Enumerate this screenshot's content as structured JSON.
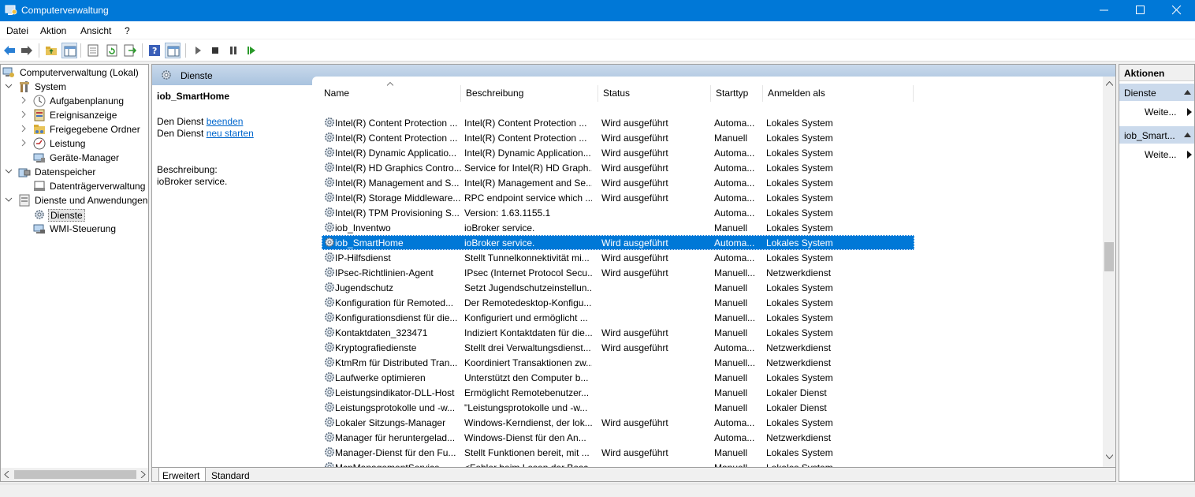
{
  "window": {
    "title": "Computerverwaltung"
  },
  "menu": [
    "Datei",
    "Aktion",
    "Ansicht",
    "?"
  ],
  "tree": {
    "root": "Computerverwaltung (Lokal)",
    "system": "System",
    "aufgaben": "Aufgabenplanung",
    "ereignis": "Ereignisanzeige",
    "freigaben": "Freigegebene Ordner",
    "leistung": "Leistung",
    "geraete": "Geräte-Manager",
    "datenspeicher": "Datenspeicher",
    "datentraeger": "Datenträgerverwaltung",
    "dienste_apps": "Dienste und Anwendungen",
    "dienste": "Dienste",
    "wmi": "WMI-Steuerung"
  },
  "center": {
    "header": "Dienste",
    "selected_service": "iob_SmartHome",
    "stop_prefix": "Den Dienst ",
    "stop_link": "beenden",
    "restart_prefix": "Den Dienst ",
    "restart_link": "neu starten",
    "desc_label": "Beschreibung:",
    "desc_value": "ioBroker service."
  },
  "columns": [
    "Name",
    "Beschreibung",
    "Status",
    "Starttyp",
    "Anmelden als"
  ],
  "rows": [
    [
      "Intel(R) Content Protection ...",
      "Intel(R) Content Protection ...",
      "Wird ausgeführt",
      "Automa...",
      "Lokales System"
    ],
    [
      "Intel(R) Content Protection ...",
      "Intel(R) Content Protection ...",
      "Wird ausgeführt",
      "Manuell",
      "Lokales System"
    ],
    [
      "Intel(R) Dynamic Applicatio...",
      "Intel(R) Dynamic Application...",
      "Wird ausgeführt",
      "Automa...",
      "Lokales System"
    ],
    [
      "Intel(R) HD Graphics Contro...",
      "Service for Intel(R) HD Graph...",
      "Wird ausgeführt",
      "Automa...",
      "Lokales System"
    ],
    [
      "Intel(R) Management and S...",
      "Intel(R) Management and Se...",
      "Wird ausgeführt",
      "Automa...",
      "Lokales System"
    ],
    [
      "Intel(R) Storage Middleware...",
      "RPC endpoint service which ...",
      "Wird ausgeführt",
      "Automa...",
      "Lokales System"
    ],
    [
      "Intel(R) TPM Provisioning S...",
      "Version: 1.63.1155.1",
      "",
      "Automa...",
      "Lokales System"
    ],
    [
      "iob_Inventwo",
      "ioBroker service.",
      "",
      "Manuell",
      "Lokales System"
    ],
    [
      "iob_SmartHome",
      "ioBroker service.",
      "Wird ausgeführt",
      "Automa...",
      "Lokales System"
    ],
    [
      "IP-Hilfsdienst",
      "Stellt Tunnelkonnektivität mi...",
      "Wird ausgeführt",
      "Automa...",
      "Lokales System"
    ],
    [
      "IPsec-Richtlinien-Agent",
      "IPsec (Internet Protocol Secu...",
      "Wird ausgeführt",
      "Manuell...",
      "Netzwerkdienst"
    ],
    [
      "Jugendschutz",
      "Setzt Jugendschutzeinstellun...",
      "",
      "Manuell",
      "Lokales System"
    ],
    [
      "Konfiguration für Remoted...",
      "Der Remotedesktop-Konfigu...",
      "",
      "Manuell",
      "Lokales System"
    ],
    [
      "Konfigurationsdienst für die...",
      "Konfiguriert und ermöglicht ...",
      "",
      "Manuell...",
      "Lokales System"
    ],
    [
      "Kontaktdaten_323471",
      "Indiziert Kontaktdaten für die...",
      "Wird ausgeführt",
      "Manuell",
      "Lokales System"
    ],
    [
      "Kryptografiedienste",
      "Stellt drei Verwaltungsdienst...",
      "Wird ausgeführt",
      "Automa...",
      "Netzwerkdienst"
    ],
    [
      "KtmRm für Distributed Tran...",
      "Koordiniert Transaktionen zw...",
      "",
      "Manuell...",
      "Netzwerkdienst"
    ],
    [
      "Laufwerke optimieren",
      "Unterstützt den Computer b...",
      "",
      "Manuell",
      "Lokales System"
    ],
    [
      "Leistungsindikator-DLL-Host",
      "Ermöglicht Remotebenutzer...",
      "",
      "Manuell",
      "Lokaler Dienst"
    ],
    [
      "Leistungsprotokolle und -w...",
      "\"Leistungsprotokolle und -w...",
      "",
      "Manuell",
      "Lokaler Dienst"
    ],
    [
      "Lokaler Sitzungs-Manager",
      "Windows-Kerndienst, der lok...",
      "Wird ausgeführt",
      "Automa...",
      "Lokales System"
    ],
    [
      "Manager für heruntergelad...",
      "Windows-Dienst für den An...",
      "",
      "Automa...",
      "Netzwerkdienst"
    ],
    [
      "Manager-Dienst für den Fu...",
      "Stellt Funktionen bereit, mit ...",
      "Wird ausgeführt",
      "Manuell",
      "Lokales System"
    ],
    [
      "McpManagementService",
      "<Fehler beim Lesen der Besc...",
      "",
      "Manuell",
      "Lokales System"
    ]
  ],
  "selected_row_index": 8,
  "tabs": [
    "Erweitert",
    "Standard"
  ],
  "actions": {
    "header": "Aktionen",
    "section1": "Dienste",
    "item1": "Weite...",
    "section2": "iob_Smart...",
    "item2": "Weite..."
  },
  "colors": {
    "titlebar": "#0078d7",
    "selection": "#0078d7",
    "link": "#0066cc"
  }
}
